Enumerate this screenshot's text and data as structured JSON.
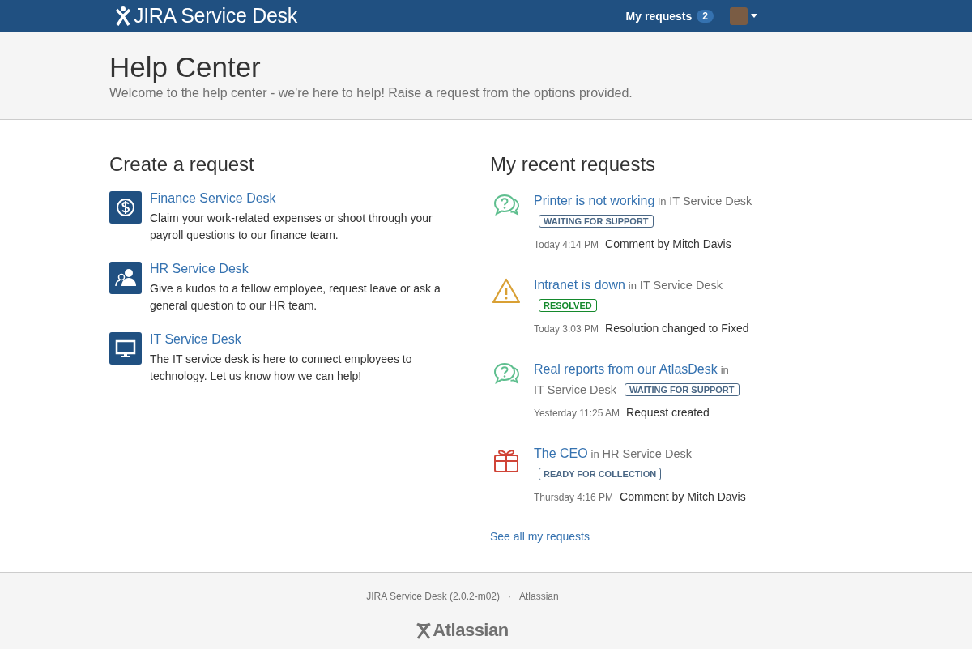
{
  "header": {
    "logo": "JIRA Service Desk",
    "my_requests": "My requests",
    "request_count": "2"
  },
  "intro": {
    "title": "Help Center",
    "subtitle": "Welcome to the help center - we're here to help! Raise a request from the options provided."
  },
  "create": {
    "heading": "Create a request",
    "desks": [
      {
        "kind": "finance",
        "name": "Finance Service Desk",
        "description": "Claim your work-related expenses or shoot through your payroll questions to our finance team."
      },
      {
        "kind": "hr",
        "name": "HR Service Desk",
        "description": "Give a kudos to a fellow employee, request leave or ask a general question to our HR team."
      },
      {
        "kind": "it",
        "name": "IT Service Desk",
        "description": "The IT service desk is here to connect employees to technology. Let us know how we can help!"
      }
    ]
  },
  "recent": {
    "heading": "My recent requests",
    "requests": [
      {
        "kind": "question",
        "title": "Printer is not working",
        "in": "in",
        "desk": "IT Service Desk",
        "status": "WAITING FOR SUPPORT",
        "color": "#4a6785",
        "time": "Today 4:14 PM",
        "activity": "Comment by Mitch Davis"
      },
      {
        "kind": "warning",
        "title": "Intranet is down",
        "in": "in",
        "desk": "IT Service Desk",
        "status": "RESOLVED",
        "color": "#14892c",
        "time": "Today 3:03 PM",
        "activity": "Resolution changed to Fixed"
      },
      {
        "kind": "question",
        "title": "Real reports from our AtlasDesk",
        "in": "in",
        "desk": "IT Service Desk",
        "status": "WAITING FOR SUPPORT",
        "color": "#4a6785",
        "time": "Yesterday 11:25 AM",
        "activity": "Request created"
      },
      {
        "kind": "gift",
        "title": "The CEO",
        "in": "in",
        "desk": "HR Service Desk",
        "status": "READY FOR COLLECTION",
        "color": "#4a6785",
        "time": "Thursday 4:16 PM",
        "activity": "Comment by Mitch Davis"
      }
    ],
    "see_all": "See all my requests"
  },
  "footer": {
    "version": "JIRA Service Desk (2.0.2-m02)",
    "separator": "·",
    "company": "Atlassian",
    "logo": "Atlassian"
  }
}
